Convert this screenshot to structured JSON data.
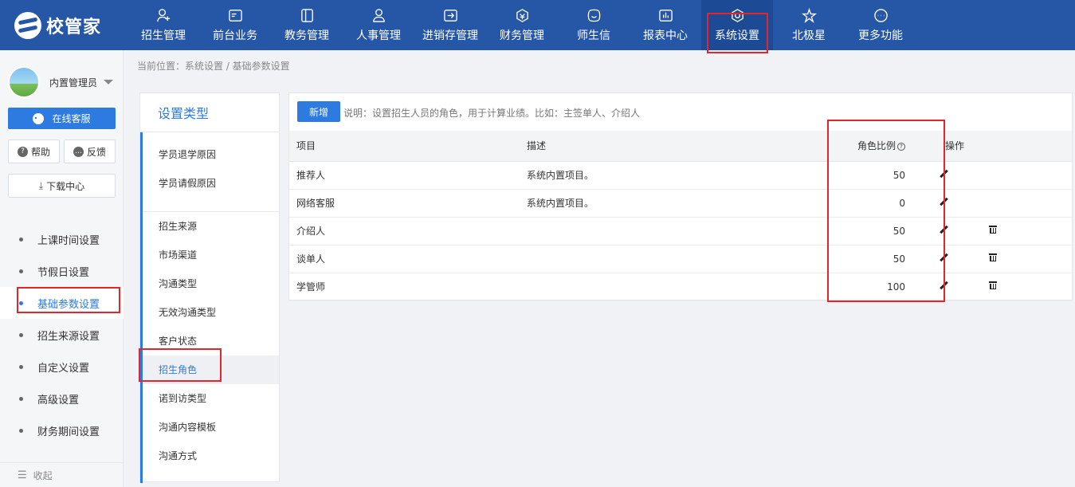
{
  "app": {
    "logo_text": "校管家"
  },
  "nav": [
    {
      "label": "招生管理",
      "icon": "user-plus-icon"
    },
    {
      "label": "前台业务",
      "icon": "desk-icon"
    },
    {
      "label": "教务管理",
      "icon": "book-icon"
    },
    {
      "label": "人事管理",
      "icon": "person-icon"
    },
    {
      "label": "进销存管理",
      "icon": "inventory-icon"
    },
    {
      "label": "财务管理",
      "icon": "finance-icon"
    },
    {
      "label": "师生信",
      "icon": "chat-icon"
    },
    {
      "label": "报表中心",
      "icon": "report-icon"
    },
    {
      "label": "系统设置",
      "icon": "settings-icon"
    },
    {
      "label": "北极星",
      "icon": "star-icon"
    },
    {
      "label": "更多功能",
      "icon": "more-icon"
    }
  ],
  "sidebar": {
    "user_name": "内置管理员",
    "service_label": "在线客服",
    "help_label": "帮助",
    "feedback_label": "反馈",
    "download_label": "下载中心",
    "items": [
      {
        "label": "上课时间设置"
      },
      {
        "label": "节假日设置"
      },
      {
        "label": "基础参数设置"
      },
      {
        "label": "招生来源设置"
      },
      {
        "label": "自定义设置"
      },
      {
        "label": "高级设置"
      },
      {
        "label": "财务期间设置"
      }
    ],
    "collapse_label": "收起"
  },
  "breadcrumb": "当前位置：系统设置 / 基础参数设置",
  "categories": {
    "title": "设置类型",
    "items": [
      {
        "label": "学员退学原因"
      },
      {
        "label": "学员请假原因"
      },
      {
        "label": "招生来源"
      },
      {
        "label": "市场渠道"
      },
      {
        "label": "沟通类型"
      },
      {
        "label": "无效沟通类型"
      },
      {
        "label": "客户状态"
      },
      {
        "label": "招生角色"
      },
      {
        "label": "诺到访类型"
      },
      {
        "label": "沟通内容模板"
      },
      {
        "label": "沟通方式"
      }
    ]
  },
  "main": {
    "add_label": "新增",
    "note": "说明：设置招生人员的角色，用于计算业绩。比如：主签单人、介绍人",
    "columns": {
      "item": "项目",
      "desc": "描述",
      "ratio": "角色比例",
      "ops": "操作"
    },
    "rows": [
      {
        "item": "推荐人",
        "desc": "系统内置项目。",
        "ratio": "50"
      },
      {
        "item": "网络客服",
        "desc": "系统内置项目。",
        "ratio": "0"
      },
      {
        "item": "介绍人",
        "desc": "",
        "ratio": "50"
      },
      {
        "item": "谈单人",
        "desc": "",
        "ratio": "50"
      },
      {
        "item": "学管师",
        "desc": "",
        "ratio": "100"
      }
    ]
  },
  "colors": {
    "header_bg": "#2656a6",
    "accent": "#2d7be0",
    "highlight_box": "#e2262b"
  }
}
